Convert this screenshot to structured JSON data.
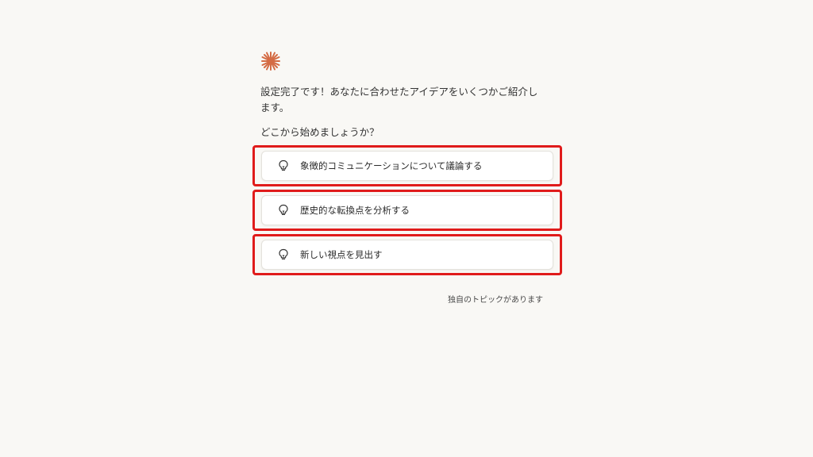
{
  "header": {
    "logo": "asterisk-logo-icon",
    "accent_color": "#d46b44"
  },
  "intro": {
    "message": "設定完了です！あなたに合わせたアイデアをいくつかご紹介します。",
    "question": "どこから始めましょうか？"
  },
  "suggestions": [
    {
      "icon": "lightbulb-icon",
      "label": "象徴的コミュニケーションについて議論する"
    },
    {
      "icon": "lightbulb-icon",
      "label": "歴史的な転換点を分析する"
    },
    {
      "icon": "lightbulb-icon",
      "label": "新しい視点を見出す"
    }
  ],
  "highlight_color": "#e01b1b",
  "footer": {
    "note": "独自のトピックがあります"
  }
}
